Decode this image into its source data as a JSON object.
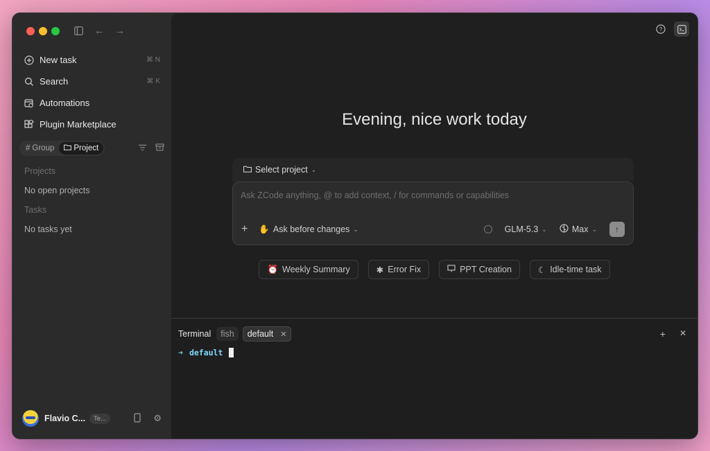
{
  "sidebar": {
    "nav": [
      {
        "label": "New task",
        "shortcut": "⌘ N",
        "icon": "new-task-icon"
      },
      {
        "label": "Search",
        "shortcut": "⌘ K",
        "icon": "search-icon"
      },
      {
        "label": "Automations",
        "shortcut": "",
        "icon": "calendar-clock-icon"
      },
      {
        "label": "Plugin Marketplace",
        "shortcut": "",
        "icon": "plugin-icon"
      }
    ],
    "filters": {
      "group": "Group",
      "project": "Project"
    },
    "projects_label": "Projects",
    "projects_empty": "No open projects",
    "tasks_label": "Tasks",
    "tasks_empty": "No tasks yet",
    "user": {
      "name": "Flavio C...",
      "badge": "Te..."
    }
  },
  "main": {
    "greeting": "Evening, nice work today",
    "composer": {
      "project_select": "Select project",
      "placeholder": "Ask ZCode anything, @ to add context, / for commands or capabilities",
      "mode": "Ask before changes",
      "model": "GLM-5.3",
      "effort": "Max"
    },
    "chips": [
      "Weekly Summary",
      "Error Fix",
      "PPT Creation",
      "Idle-time task"
    ]
  },
  "terminal": {
    "title": "Terminal",
    "tabs": [
      "fish",
      "default"
    ],
    "prompt_arrow": "➜",
    "cwd": "default"
  },
  "colors": {
    "window_bg": "#2b2b2b",
    "main_bg": "#1f1f1f",
    "close": "#ff5f57",
    "minimize": "#febc2e",
    "zoom": "#28c840",
    "terminal_cwd": "#7fd8ff"
  }
}
